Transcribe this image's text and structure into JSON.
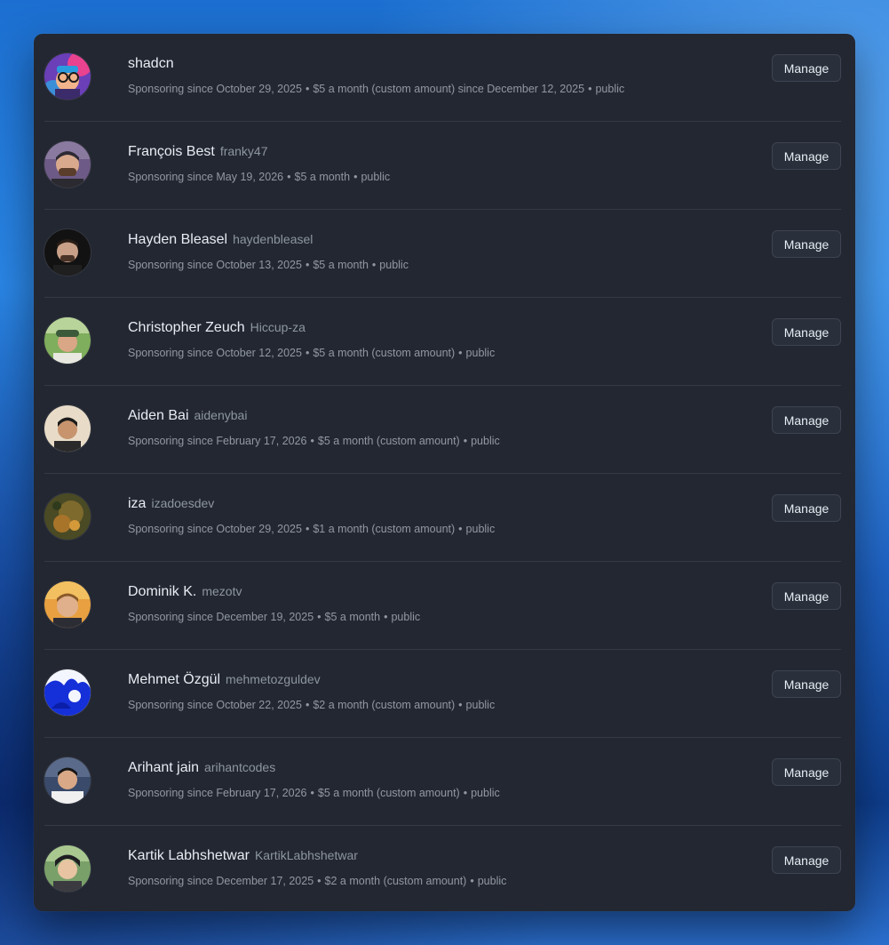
{
  "separator": "•",
  "sponsors": [
    {
      "name": "shadcn",
      "login": "",
      "since": "Sponsoring since October 29, 2025",
      "tier": "$5 a month (custom amount) since December 12, 2025",
      "visibility": "public",
      "manage_label": "Manage",
      "avatar": "shadcn-avatar-icon"
    },
    {
      "name": "François Best",
      "login": "franky47",
      "since": "Sponsoring since May 19, 2026",
      "tier": "$5 a month",
      "visibility": "public",
      "manage_label": "Manage",
      "avatar": "franky47-avatar-icon"
    },
    {
      "name": "Hayden Bleasel",
      "login": "haydenbleasel",
      "since": "Sponsoring since October 13, 2025",
      "tier": "$5 a month",
      "visibility": "public",
      "manage_label": "Manage",
      "avatar": "haydenbleasel-avatar-icon"
    },
    {
      "name": "Christopher Zeuch",
      "login": "Hiccup-za",
      "since": "Sponsoring since October 12, 2025",
      "tier": "$5 a month (custom amount)",
      "visibility": "public",
      "manage_label": "Manage",
      "avatar": "hiccup-za-avatar-icon"
    },
    {
      "name": "Aiden Bai",
      "login": "aidenybai",
      "since": "Sponsoring since February 17, 2026",
      "tier": "$5 a month (custom amount)",
      "visibility": "public",
      "manage_label": "Manage",
      "avatar": "aidenybai-avatar-icon"
    },
    {
      "name": "iza",
      "login": "izadoesdev",
      "since": "Sponsoring since October 29, 2025",
      "tier": "$1 a month (custom amount)",
      "visibility": "public",
      "manage_label": "Manage",
      "avatar": "izadoesdev-avatar-icon"
    },
    {
      "name": "Dominik K.",
      "login": "mezotv",
      "since": "Sponsoring since December 19, 2025",
      "tier": "$5 a month",
      "visibility": "public",
      "manage_label": "Manage",
      "avatar": "mezotv-avatar-icon"
    },
    {
      "name": "Mehmet Özgül",
      "login": "mehmetozguldev",
      "since": "Sponsoring since October 22, 2025",
      "tier": "$2 a month (custom amount)",
      "visibility": "public",
      "manage_label": "Manage",
      "avatar": "mehmetozguldev-avatar-icon"
    },
    {
      "name": "Arihant jain",
      "login": "arihantcodes",
      "since": "Sponsoring since February 17, 2026",
      "tier": "$5 a month (custom amount)",
      "visibility": "public",
      "manage_label": "Manage",
      "avatar": "arihantcodes-avatar-icon"
    },
    {
      "name": "Kartik Labhshetwar",
      "login": "KartikLabhshetwar",
      "since": "Sponsoring since December 17, 2025",
      "tier": "$2 a month (custom amount)",
      "visibility": "public",
      "manage_label": "Manage",
      "avatar": "kartiklabhshetwar-avatar-icon"
    }
  ]
}
